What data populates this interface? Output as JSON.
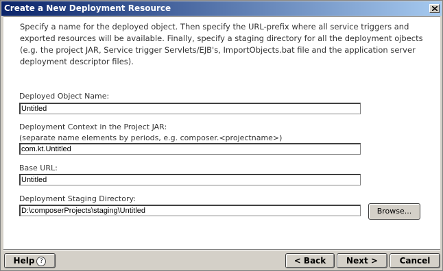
{
  "window": {
    "title": "Create a New Deployment Resource"
  },
  "description": "Specify a name for the deployed object.  Then specify the URL-prefix where all service triggers and exported resources will be available.  Finally, specify a staging directory for all the deployment ojbects (e.g. the project JAR, Service trigger Servlets/EJB's, ImportObjects.bat file and the application server deployment descriptor files).",
  "fields": {
    "deployed_object_name": {
      "label": "Deployed Object Name:",
      "value": "Untitled"
    },
    "deployment_context": {
      "label": "Deployment Context in the Project JAR:",
      "hint": "(separate name elements by periods, e.g. composer.<projectname>)",
      "value": "com.kt.Untitled"
    },
    "base_url": {
      "label": "Base URL:",
      "value": "Untitled"
    },
    "staging_directory": {
      "label": "Deployment Staging Directory:",
      "value": "D:\\composerProjects\\staging\\Untitled"
    }
  },
  "buttons": {
    "browse": "Browse...",
    "help": "Help",
    "help_icon": "?",
    "back": "< Back",
    "next": "Next >",
    "cancel": "Cancel"
  }
}
